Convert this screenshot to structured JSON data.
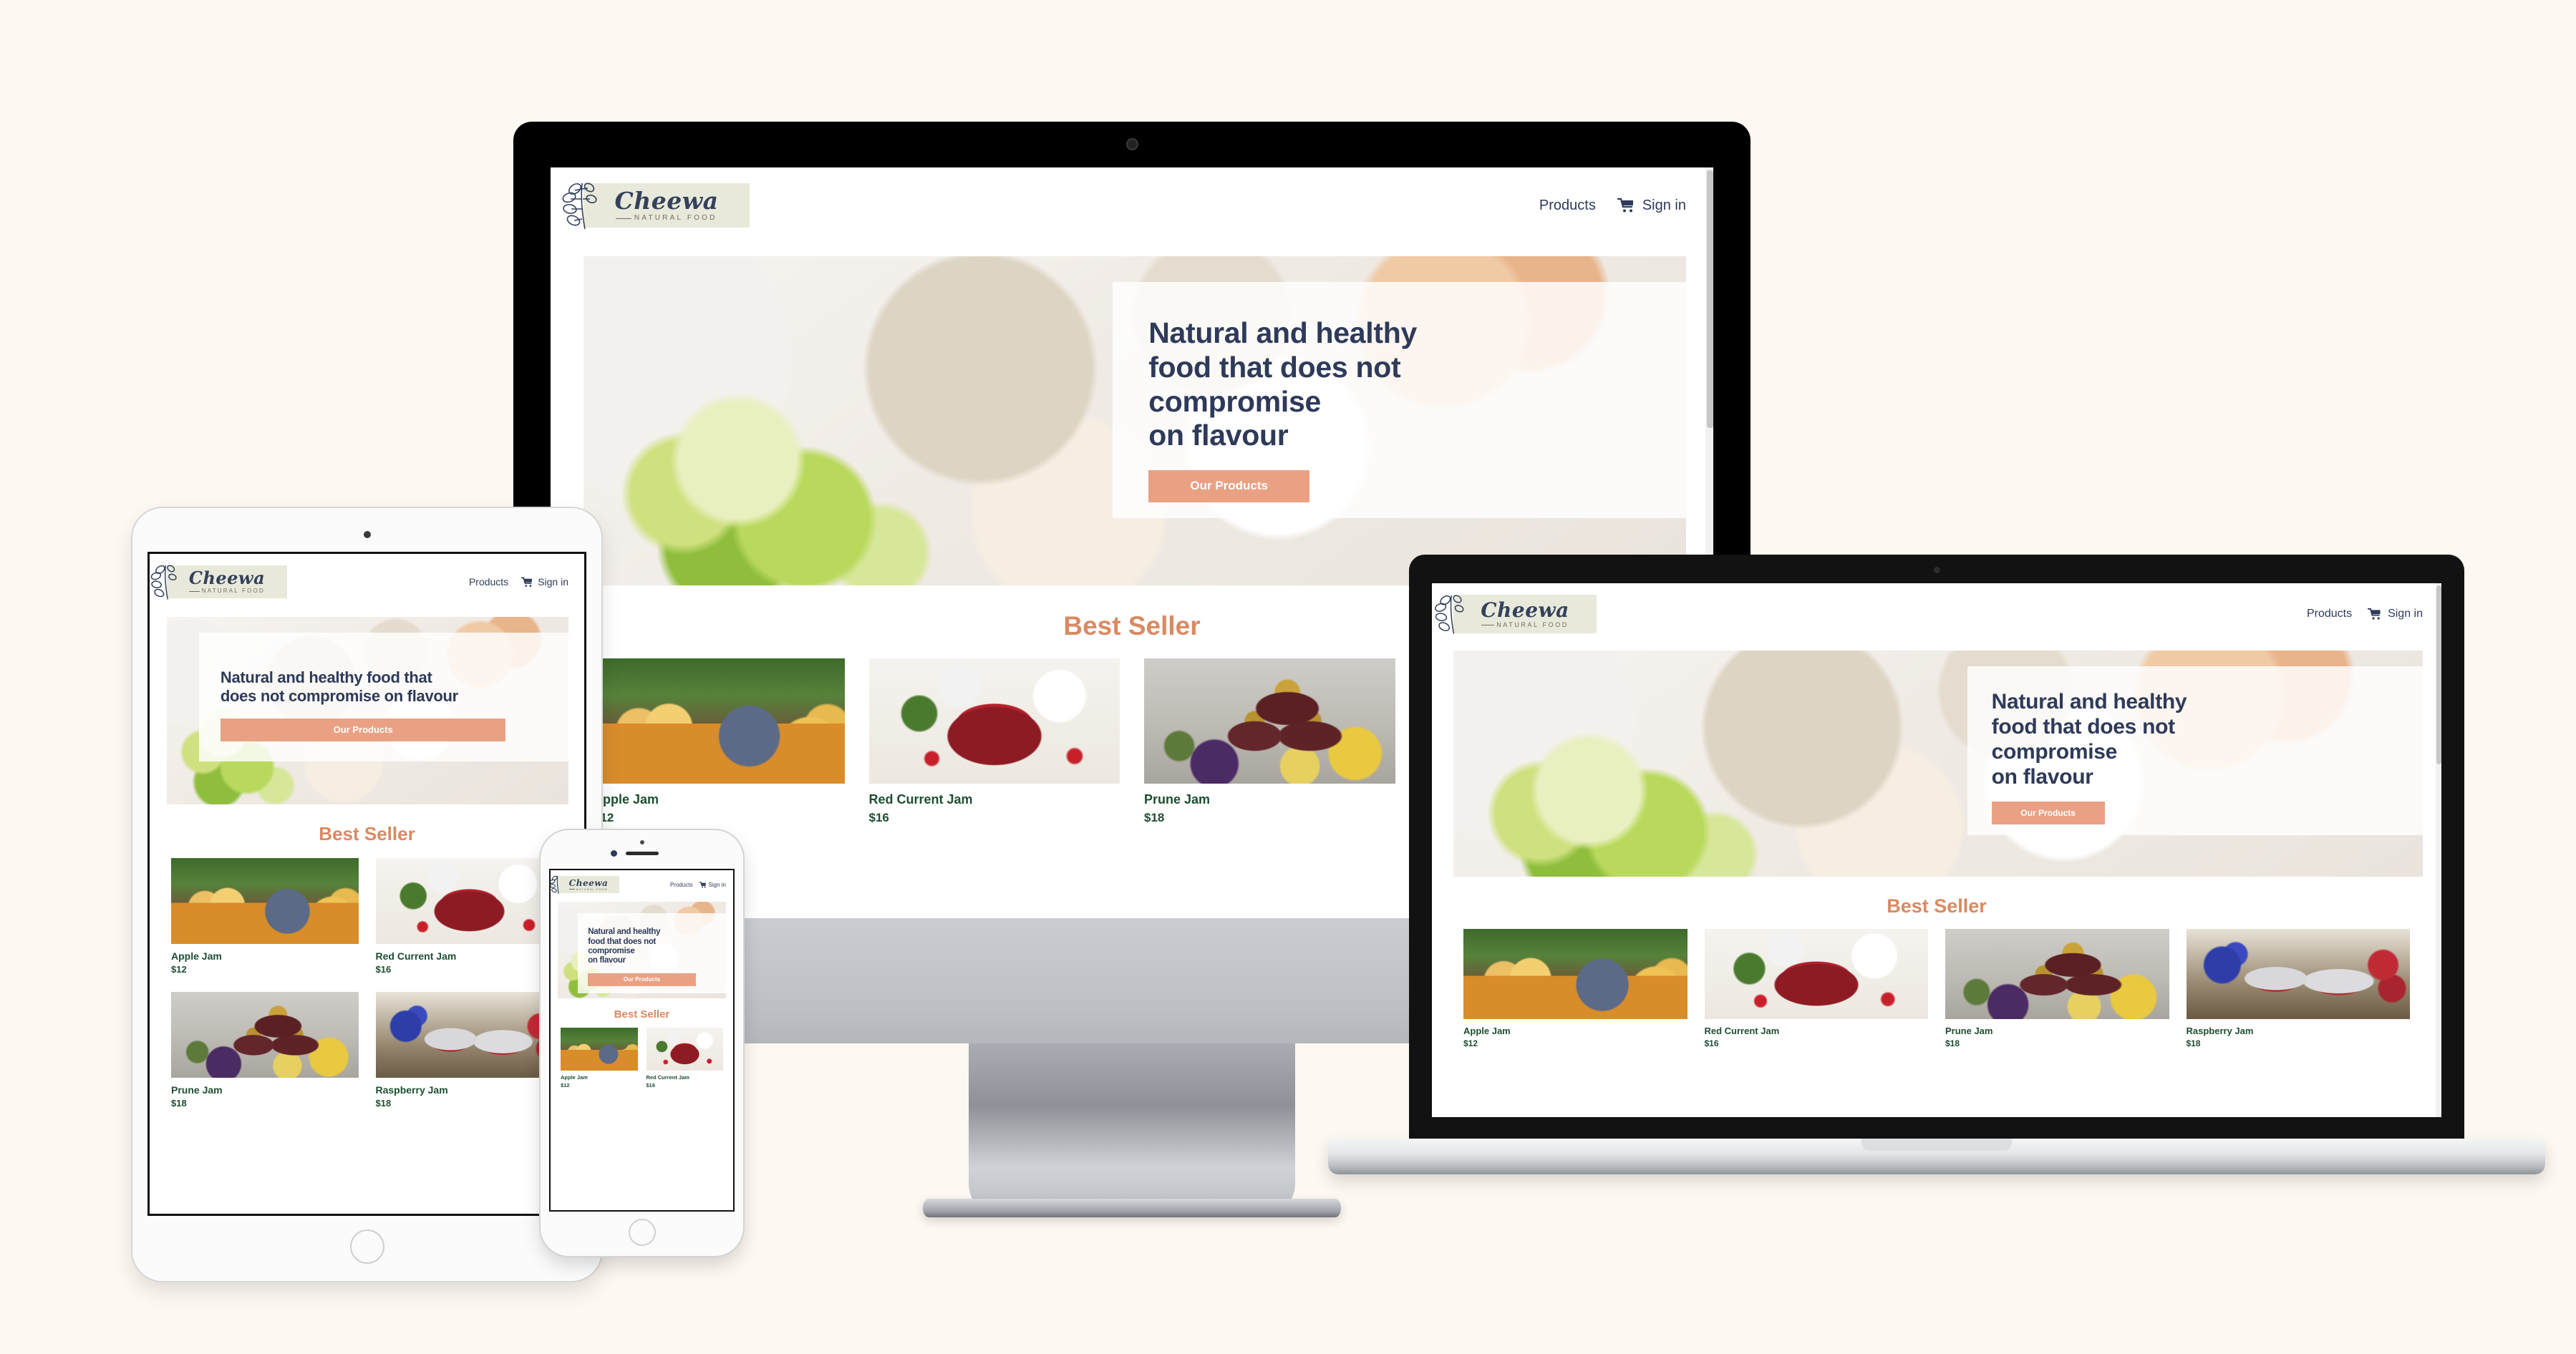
{
  "background_color": "#fdf8f1",
  "brand": {
    "name": "Cheewa",
    "tagline": "NATURAL FOOD",
    "logo_bg": "#e8e9da",
    "logo_text_color": "#33415c",
    "leaf_icon": "leaf-sprig-icon"
  },
  "nav": {
    "products_label": "Products",
    "signin_label": "Sign in",
    "cart_icon": "shopping-cart-icon",
    "text_color": "#2e3a59"
  },
  "hero": {
    "headline": "Natural and healthy\nfood that does not\ncompromise\non flavour",
    "headline_two_line": "Natural and healthy food that\ndoes not compromise on flavour",
    "cta_label": "Our Products",
    "cta_bg": "#eaa183",
    "headline_color": "#2e3a59",
    "photo": "breakfast-bowls-berries-coffee-photo"
  },
  "best_seller": {
    "title": "Best Seller",
    "title_color": "#d98a62",
    "products": [
      {
        "name": "Apple Jam",
        "price": "$12",
        "image": "apple-jam-jar-photo",
        "swatch": "ph-apple"
      },
      {
        "name": "Red Current Jam",
        "price": "$16",
        "image": "red-currant-jam-photo",
        "swatch": "ph-currant"
      },
      {
        "name": "Prune Jam",
        "price": "$18",
        "image": "prune-jam-jars-photo",
        "swatch": "ph-prune"
      },
      {
        "name": "Raspberry Jam",
        "price": "$18",
        "image": "raspberry-jam-jars-photo",
        "swatch": "ph-rasp"
      }
    ]
  },
  "devices": [
    {
      "id": "imac",
      "label": "desktop-imac-mockup"
    },
    {
      "id": "tablet",
      "label": "tablet-ipad-mockup"
    },
    {
      "id": "phone",
      "label": "phone-iphone-mockup"
    },
    {
      "id": "laptop",
      "label": "laptop-macbook-mockup"
    }
  ]
}
